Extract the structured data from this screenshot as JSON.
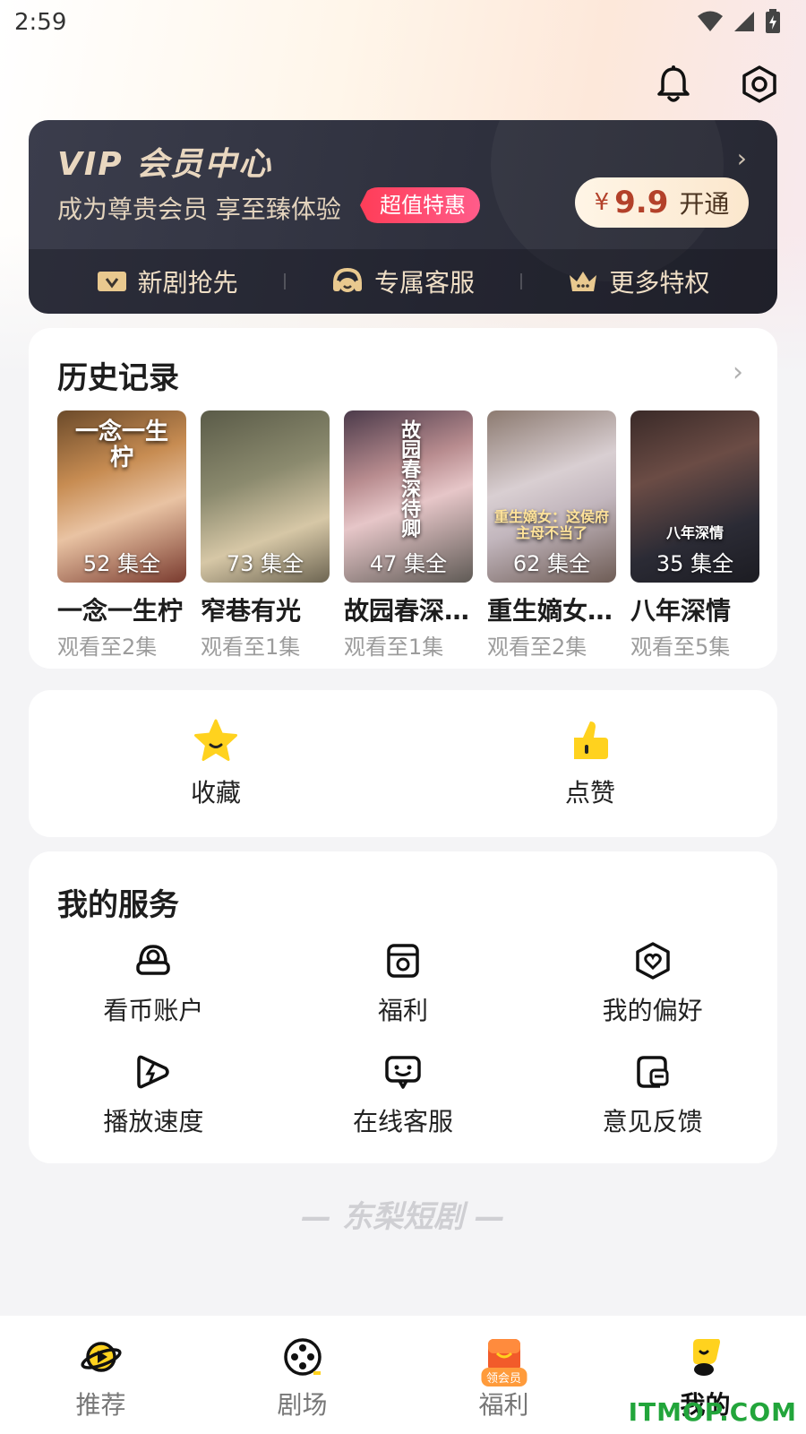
{
  "status_bar": {
    "time": "2:59"
  },
  "vip": {
    "title": "VIP 会员中心",
    "subtitle": "成为尊贵会员 享至臻体验",
    "badge": "超值特惠",
    "currency": "¥",
    "price": "9.9",
    "open_label": "开通",
    "perks": [
      {
        "label": "新剧抢先",
        "icon": "ticket-icon"
      },
      {
        "label": "专属客服",
        "icon": "headset-icon"
      },
      {
        "label": "更多特权",
        "icon": "crown-icon"
      }
    ],
    "accent": "#e9d7bf"
  },
  "history": {
    "title": "历史记录",
    "items": [
      {
        "name": "一念一生柠",
        "poster_text": "一念一生柠",
        "episodes": "52 集全",
        "progress": "观看至2集"
      },
      {
        "name": "窄巷有光",
        "poster_text": "",
        "episodes": "73 集全",
        "progress": "观看至1集"
      },
      {
        "name": "故园春深待卿",
        "poster_text": "故园春深待卿",
        "episodes": "47 集全",
        "progress": "观看至1集"
      },
      {
        "name": "重生嫡女：这侯府主母不当了",
        "poster_text": "重生嫡女：这侯府主母不当了",
        "episodes": "62 集全",
        "progress": "观看至2集"
      },
      {
        "name": "八年深情",
        "poster_text": "八年深情",
        "episodes": "35 集全",
        "progress": "观看至5集"
      }
    ]
  },
  "quick_actions": [
    {
      "label": "收藏",
      "icon": "star-icon"
    },
    {
      "label": "点赞",
      "icon": "thumbs-up-icon"
    }
  ],
  "services": {
    "title": "我的服务",
    "items": [
      {
        "label": "看币账户",
        "icon": "coin-account-icon"
      },
      {
        "label": "福利",
        "icon": "gift-icon"
      },
      {
        "label": "我的偏好",
        "icon": "heart-shield-icon"
      },
      {
        "label": "播放速度",
        "icon": "speed-icon"
      },
      {
        "label": "在线客服",
        "icon": "chat-icon"
      },
      {
        "label": "意见反馈",
        "icon": "feedback-icon"
      }
    ]
  },
  "brand_footer": "— 东梨短剧 —",
  "bottom_nav": [
    {
      "label": "推荐",
      "icon": "planet-play-icon"
    },
    {
      "label": "剧场",
      "icon": "film-reel-icon"
    },
    {
      "label": "福利",
      "icon": "gift-box-icon",
      "badge": "领会员"
    },
    {
      "label": "我的",
      "icon": "profile-icon",
      "active": true
    }
  ],
  "watermark": "ITMOP.COM",
  "colors": {
    "accent_yellow": "#ffd21e",
    "badge_pink": "#ff3d58",
    "price_red": "#b3412a"
  }
}
